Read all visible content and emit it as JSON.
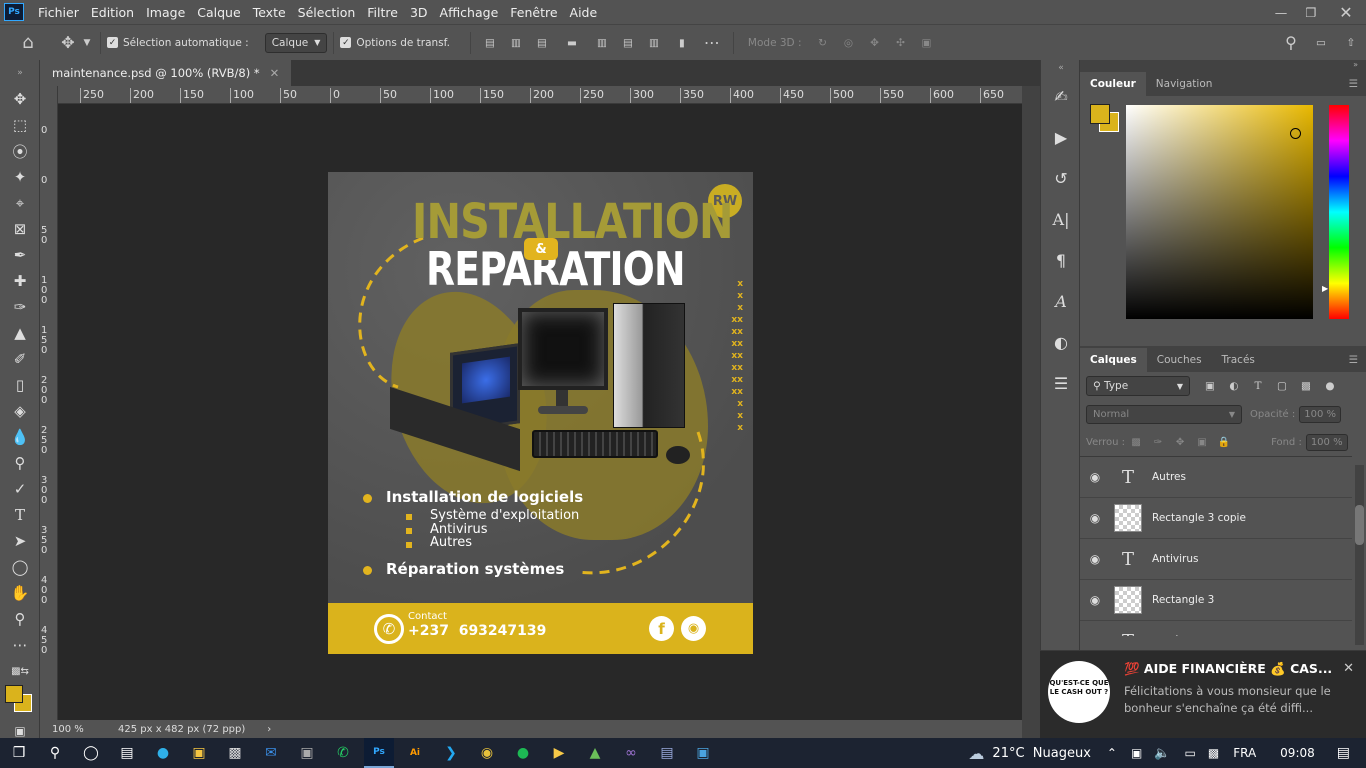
{
  "menu": [
    "Fichier",
    "Edition",
    "Image",
    "Calque",
    "Texte",
    "Sélection",
    "Filtre",
    "3D",
    "Affichage",
    "Fenêtre",
    "Aide"
  ],
  "options": {
    "auto_select_label": "Sélection automatique :",
    "auto_select_value": "Calque",
    "transform_label": "Options de transf.",
    "mode3d_label": "Mode 3D :"
  },
  "document": {
    "tab_title": "maintenance.psd @ 100% (RVB/8) *"
  },
  "rulers": {
    "top_labels": [
      "250",
      "200",
      "150",
      "100",
      "50",
      "0",
      "50",
      "100",
      "150",
      "200",
      "250",
      "300",
      "350",
      "400",
      "450",
      "500",
      "550",
      "600",
      "650"
    ],
    "left_labels": [
      "0",
      "0",
      "5 0",
      "1 0 0",
      "1 5 0",
      "2 0 0",
      "2 5 0",
      "3 0 0",
      "3 5 0",
      "4 0 0",
      "4 5 0"
    ]
  },
  "status": {
    "zoom": "100 %",
    "size": "425 px x 482 px (72 ppp)"
  },
  "poster": {
    "headline1": "INSTALLATION",
    "amp": "&",
    "headline2": "REPARATION",
    "bullet1": "Installation de logiciels",
    "sub1": "Système d'exploitation",
    "sub2": "Antivirus",
    "sub3": "Autres",
    "bullet2": "Réparation systèmes",
    "contact_label": "Contact",
    "phone": "+237  693247139",
    "xx_marks": "x\nx\nx\nxx\nxx\nxx\nxx\nxx\nxx\nxx\nx\nx\nx"
  },
  "color_panel": {
    "tabs": [
      "Couleur",
      "Navigation"
    ],
    "fg_color": "#dab31c"
  },
  "layers_panel": {
    "tabs": [
      "Calques",
      "Couches",
      "Tracés"
    ],
    "filter_label": "Type",
    "blend_mode": "Normal",
    "opacity_label": "Opacité :",
    "opacity_value": "100 %",
    "lock_label": "Verrou :",
    "fill_label": "Fond :",
    "fill_value": "100 %",
    "layers": [
      {
        "name": "Autres",
        "kind": "text"
      },
      {
        "name": "Rectangle 3 copie",
        "kind": "raster"
      },
      {
        "name": "Antivirus",
        "kind": "text"
      },
      {
        "name": "Rectangle 3",
        "kind": "raster"
      },
      {
        "name": "Système d'exploitation",
        "kind": "text"
      }
    ]
  },
  "notification": {
    "badge_text": "QU'EST-CE QUE LE CASH OUT ?",
    "title": "💯 AIDE FINANCIÈRE 💰 CAS...",
    "body": "Félicitations à vous monsieur que le bonheur s'enchaîne ça été diffi..."
  },
  "taskbar": {
    "weather": "21°C  Nuageux",
    "lang": "FRA",
    "time": "09:08"
  }
}
